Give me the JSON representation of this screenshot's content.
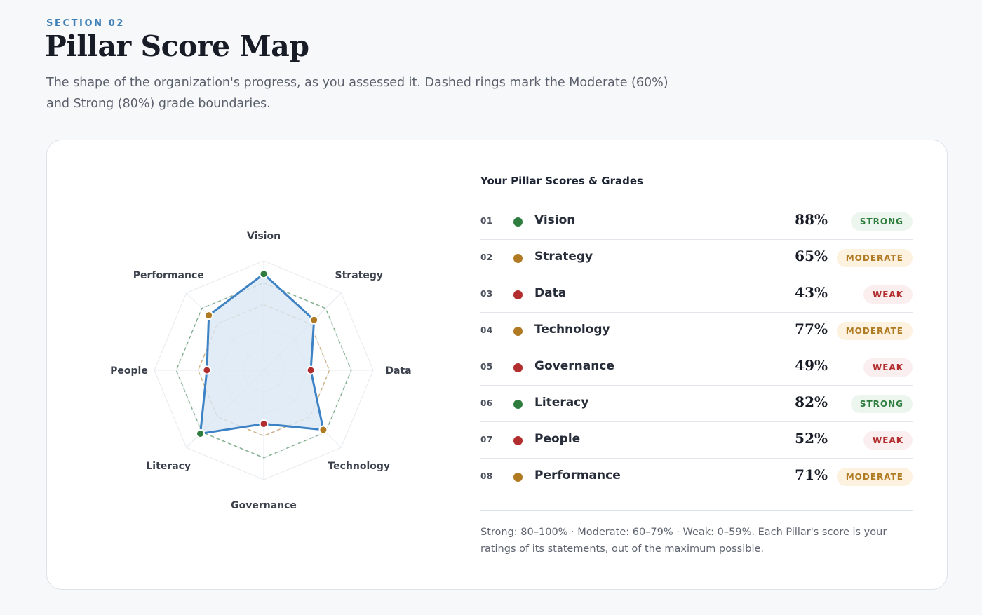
{
  "header": {
    "eyebrow": "SECTION 02",
    "title": "Pillar Score Map",
    "subtitle": "The shape of the organization's progress, as you assessed it. Dashed rings mark the Moderate (60%) and Strong (80%) grade boundaries."
  },
  "panel": {
    "title": "Your Pillar Scores & Grades",
    "footnote": "Strong: 80–100% · Moderate: 60–79% · Weak: 0–59%. Each Pillar's score is your ratings of its statements, out of the maximum possible."
  },
  "colors": {
    "strong": "#2e7d3e",
    "moderate": "#b07a22",
    "weak": "#b22d2d",
    "series": "#3d82c4",
    "fill": "#dbe7f4"
  },
  "pillars": [
    {
      "num": "01",
      "name": "Vision",
      "score": "88%",
      "grade": "STRONG",
      "level": "strong"
    },
    {
      "num": "02",
      "name": "Strategy",
      "score": "65%",
      "grade": "MODERATE",
      "level": "moderate"
    },
    {
      "num": "03",
      "name": "Data",
      "score": "43%",
      "grade": "WEAK",
      "level": "weak"
    },
    {
      "num": "04",
      "name": "Technology",
      "score": "77%",
      "grade": "MODERATE",
      "level": "moderate"
    },
    {
      "num": "05",
      "name": "Governance",
      "score": "49%",
      "grade": "WEAK",
      "level": "weak"
    },
    {
      "num": "06",
      "name": "Literacy",
      "score": "82%",
      "grade": "STRONG",
      "level": "strong"
    },
    {
      "num": "07",
      "name": "People",
      "score": "52%",
      "grade": "WEAK",
      "level": "weak"
    },
    {
      "num": "08",
      "name": "Performance",
      "score": "71%",
      "grade": "MODERATE",
      "level": "moderate"
    }
  ],
  "chart_data": {
    "type": "radar",
    "categories": [
      "Vision",
      "Strategy",
      "Data",
      "Technology",
      "Governance",
      "Literacy",
      "People",
      "Performance"
    ],
    "values": [
      88,
      65,
      43,
      77,
      49,
      82,
      52,
      71
    ],
    "ylim": [
      0,
      100
    ],
    "reference_rings": [
      60,
      80
    ],
    "grid_rings": [
      20,
      40,
      60,
      80,
      100
    ],
    "grid": true,
    "legend": "none"
  }
}
